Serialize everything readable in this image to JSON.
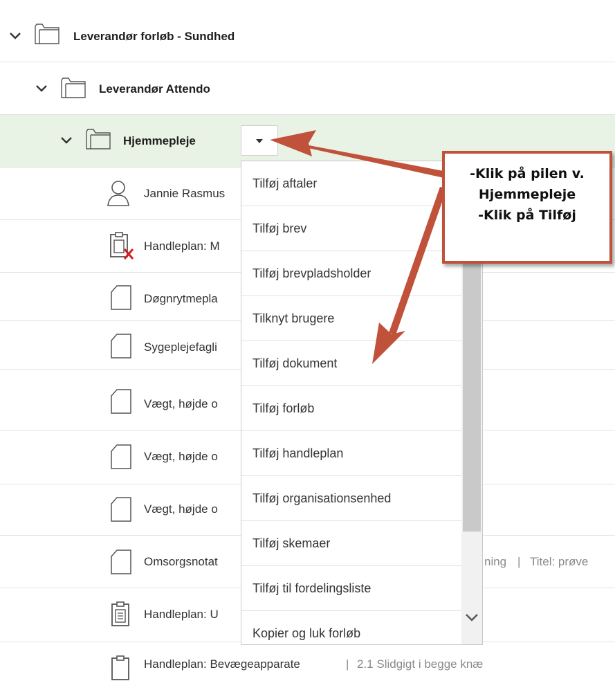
{
  "tree": {
    "rows": [
      {
        "label": "Leverandør forløb - Sundhed",
        "bold": true
      },
      {
        "label": "Leverandør Attendo",
        "bold": true
      },
      {
        "label": "Hjemmepleje",
        "bold": true
      },
      {
        "label": "Jannie Rasmus"
      },
      {
        "label": "Handleplan: M"
      },
      {
        "label": "Døgnrytmepla"
      },
      {
        "label": "Sygeplejefagli"
      },
      {
        "label": "Vægt, højde o"
      },
      {
        "label": "Vægt, højde o"
      },
      {
        "label": "Vægt, højde o"
      },
      {
        "label": "Omsorgsnotat"
      },
      {
        "label": "Handleplan: U"
      },
      {
        "label": "Handleplan: Bevægeapparate"
      }
    ],
    "omsorg_suffix_1": "ning",
    "omsorg_separator": "|",
    "omsorg_suffix_2": "Titel: prøve",
    "last_row_separator": "|",
    "last_row_suffix": "2.1 Slidgigt i begge knæ"
  },
  "dropdown_menu": {
    "items": [
      "Tilføj aftaler",
      "Tilføj brev",
      "Tilføj brevpladsholder",
      "Tilknyt brugere",
      "Tilføj dokument",
      "Tilføj forløb",
      "Tilføj handleplan",
      "Tilføj organisationsenhed",
      "Tilføj skemaer",
      "Tilføj til fordelingsliste",
      "Kopier og luk forløb"
    ]
  },
  "callout": {
    "line1": "-Klik på pilen v.",
    "line2": "Hjemmepleje",
    "line3": "-Klik på Tilføj"
  },
  "colors": {
    "selected_row": "#e9f3e5",
    "annotation": "#c0513a"
  },
  "icons": [
    "chevron-down-icon",
    "folder-icon",
    "user-icon",
    "handleplan-icon",
    "document-icon",
    "caret-down-icon"
  ]
}
